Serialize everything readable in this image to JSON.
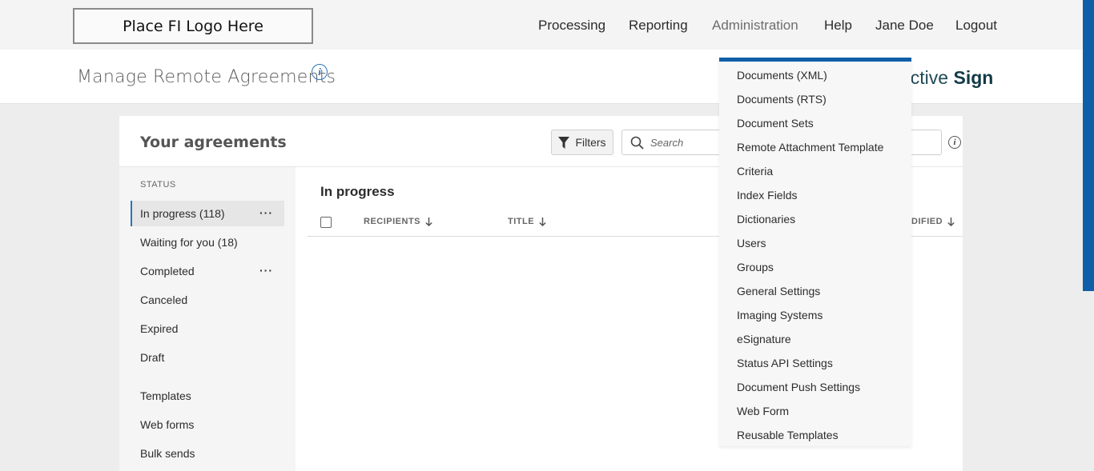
{
  "logo": {
    "text": "Place FI Logo Here"
  },
  "nav": [
    {
      "label": "Processing"
    },
    {
      "label": "Reporting"
    },
    {
      "label": "Administration"
    },
    {
      "label": "Help"
    },
    {
      "label": "Jane Doe"
    },
    {
      "label": "Logout"
    }
  ],
  "header": {
    "title": "Manage Remote Agreements",
    "info_icon": "i",
    "brand_regular": "ective ",
    "brand_bold": "Sign"
  },
  "card": {
    "title": "Your agreements",
    "filters_label": "Filters",
    "search_placeholder": "Search",
    "info_icon": "i"
  },
  "sidebar": {
    "status_label": "STATUS",
    "items": [
      {
        "label": "In progress (118)",
        "more": "···"
      },
      {
        "label": "Waiting for you (18)"
      },
      {
        "label": "Completed",
        "more": "···"
      },
      {
        "label": "Canceled"
      },
      {
        "label": "Expired"
      },
      {
        "label": "Draft"
      },
      {
        "label": "Templates"
      },
      {
        "label": "Web forms"
      },
      {
        "label": "Bulk sends"
      }
    ]
  },
  "content": {
    "title": "In progress",
    "columns": [
      {
        "label": "RECIPIENTS"
      },
      {
        "label": "TITLE"
      },
      {
        "label": "DIFIED"
      }
    ]
  },
  "admin_menu": {
    "items": [
      "Documents (XML)",
      "Documents (RTS)",
      "Document Sets",
      "Remote Attachment Template",
      "Criteria",
      "Index Fields",
      "Dictionaries",
      "Users",
      "Groups",
      "General Settings",
      "Imaging Systems",
      "eSignature",
      "Status API Settings",
      "Document Push Settings",
      "Web Form",
      "Reusable Templates"
    ]
  },
  "colors": {
    "accent": "#0f5fa8",
    "info_blue": "#2d74b9",
    "brand": "#123b48"
  }
}
